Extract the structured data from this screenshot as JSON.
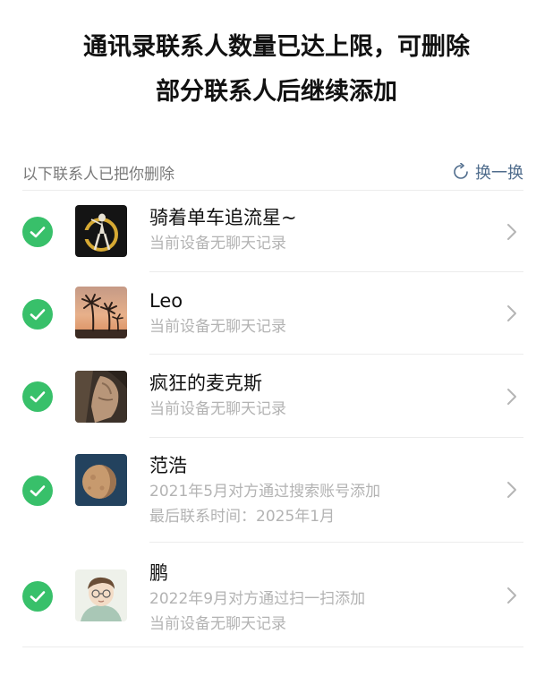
{
  "title": {
    "line1": "通讯录联系人数量已达上限，可删除",
    "line2": "部分联系人后继续添加"
  },
  "section": {
    "label": "以下联系人已把你删除",
    "refresh_label": "换一换"
  },
  "contacts": [
    {
      "name": "骑着单车追流星~",
      "lines": [
        "当前设备无聊天记录"
      ],
      "selected": true
    },
    {
      "name": "Leo",
      "lines": [
        "当前设备无聊天记录"
      ],
      "selected": true
    },
    {
      "name": "疯狂的麦克斯",
      "lines": [
        "当前设备无聊天记录"
      ],
      "selected": true
    },
    {
      "name": "范浩",
      "lines": [
        "2021年5月对方通过搜索账号添加",
        "最后联系时间：2025年1月"
      ],
      "selected": true
    },
    {
      "name": "鹏",
      "lines": [
        "2022年9月对方通过扫一扫添加",
        "当前设备无聊天记录"
      ],
      "selected": true
    }
  ],
  "colors": {
    "check_green": "#38c06a",
    "link_blue": "#4f6c8c",
    "secondary_text": "#b3b3b3"
  }
}
